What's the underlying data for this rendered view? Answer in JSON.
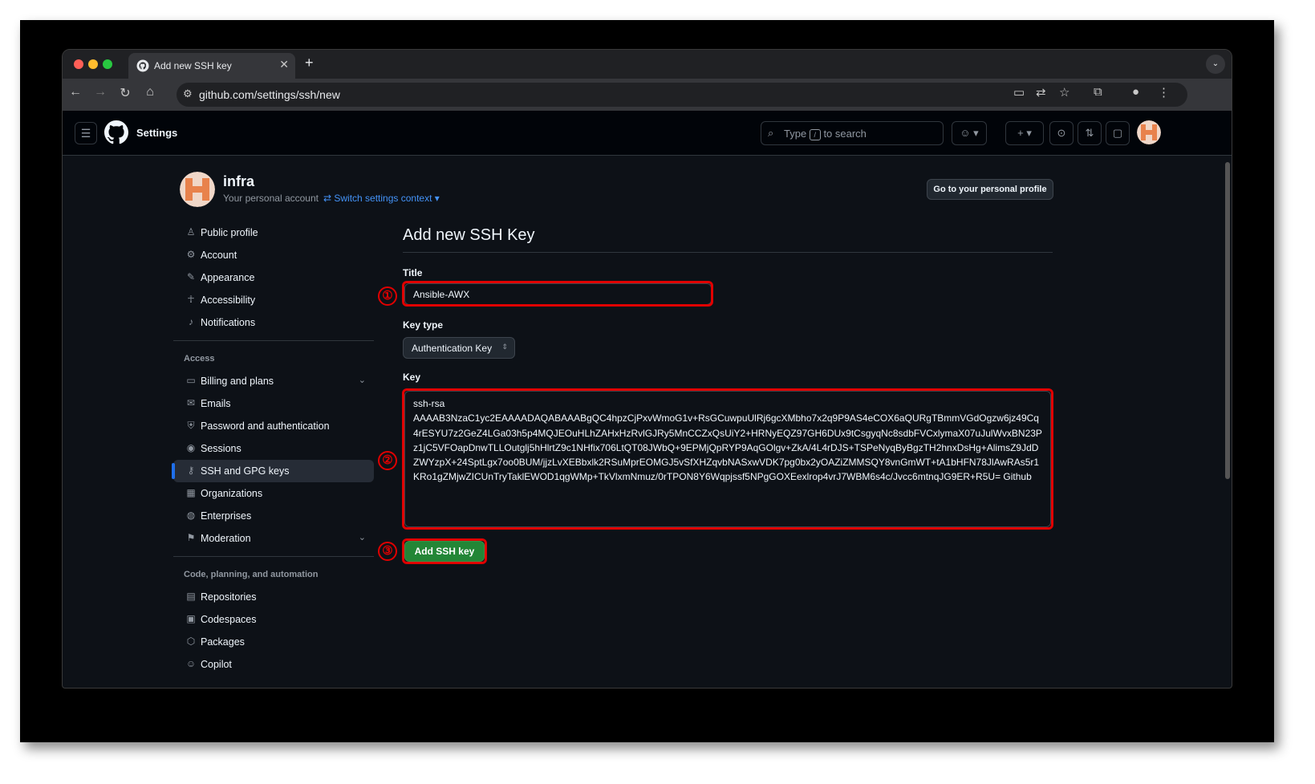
{
  "browser": {
    "tab_title": "Add new SSH key",
    "url": "github.com/settings/ssh/new"
  },
  "header": {
    "title": "Settings",
    "search_prefix": "Type",
    "search_key": "/",
    "search_suffix": "to search"
  },
  "profile": {
    "username": "infra",
    "subtitle": "Your personal account",
    "switch_context": "Switch settings context",
    "go_to_profile": "Go to your personal profile"
  },
  "sidebar": {
    "top_items": [
      {
        "label": "Public profile",
        "icon": "person-icon"
      },
      {
        "label": "Account",
        "icon": "gear-icon"
      },
      {
        "label": "Appearance",
        "icon": "paintbrush-icon"
      },
      {
        "label": "Accessibility",
        "icon": "accessibility-icon"
      },
      {
        "label": "Notifications",
        "icon": "bell-icon"
      }
    ],
    "access_heading": "Access",
    "access_items": [
      {
        "label": "Billing and plans",
        "icon": "credit-card-icon",
        "expandable": true
      },
      {
        "label": "Emails",
        "icon": "mail-icon"
      },
      {
        "label": "Password and authentication",
        "icon": "shield-lock-icon"
      },
      {
        "label": "Sessions",
        "icon": "broadcast-icon"
      },
      {
        "label": "SSH and GPG keys",
        "icon": "key-icon",
        "active": true
      },
      {
        "label": "Organizations",
        "icon": "organization-icon"
      },
      {
        "label": "Enterprises",
        "icon": "globe-icon"
      },
      {
        "label": "Moderation",
        "icon": "report-icon",
        "expandable": true
      }
    ],
    "code_heading": "Code, planning, and automation",
    "code_items": [
      {
        "label": "Repositories",
        "icon": "repo-icon"
      },
      {
        "label": "Codespaces",
        "icon": "codespaces-icon"
      },
      {
        "label": "Packages",
        "icon": "package-icon"
      },
      {
        "label": "Copilot",
        "icon": "copilot-icon"
      }
    ]
  },
  "form": {
    "heading": "Add new SSH Key",
    "title_label": "Title",
    "title_value": "Ansible-AWX",
    "key_type_label": "Key type",
    "key_type_value": "Authentication Key",
    "key_label": "Key",
    "key_value_line1": "ssh-rsa",
    "key_value_body": "AAAAB3NzaC1yc2EAAAADAQABAAABgQC4hpzCjPxvWmoG1v+RsGCuwpuUlRj6gcXMbho7x2q9P9AS4eCOX6aQURgTBmmVGdOgzw6jz49Cq4rESYU7z2GeZ4LGa03h5p4MQJEOuHLhZAHxHzRvlGJRy5MnCCZxQsUiY2+HRNyEQZ97GH6DUx9tCsgyqNc8sdbFVCxlymaX07uJulWvxBN23Pz1jC5VFOapDnwTLLOutglj5hHlrtZ9c1NHfix706LtQT08JWbQ+9EPMjQpRYP9AqGOlgv+ZkA/4L4rDJS+TSPeNyqByBgzTH2hnxDsHg+AlimsZ9JdDZWYzpX+24SptLgx7oo0BUM/jjzLvXEBbxlk2RSuMprEOMGJ5vSfXHZqvbNASxwVDK7pg0bx2yOAZiZMMSQY8vnGmWT+tA1bHFN78JlAwRAs5r1KRo1gZMjwZICUnTryTaklEWOD1qgWMp+TkVlxmNmuz/0rTPON8Y6Wqpjssf5NPgGOXEexlrop4vrJ7WBM6s4c/Jvcc6mtnqJG9ER+R5U= Github",
    "submit_label": "Add SSH key"
  },
  "annotations": [
    "①",
    "②",
    "③"
  ],
  "colors": {
    "annotation_red": "#e00000",
    "primary_green": "#238636",
    "link_blue": "#4493f8",
    "background": "#0d1117"
  }
}
